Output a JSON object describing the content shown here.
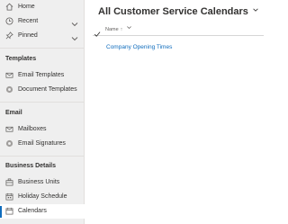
{
  "sidebar": {
    "items": {
      "home": {
        "label": "Home",
        "icon": "home-icon"
      },
      "recent": {
        "label": "Recent",
        "icon": "clock-icon"
      },
      "pinned": {
        "label": "Pinned",
        "icon": "pin-icon"
      },
      "email_templates": {
        "label": "Email Templates",
        "icon": "email-template-icon"
      },
      "document_templates": {
        "label": "Document Templates",
        "icon": "document-template-icon"
      },
      "mailboxes": {
        "label": "Mailboxes",
        "icon": "mailbox-icon"
      },
      "email_signatures": {
        "label": "Email Signatures",
        "icon": "signature-icon"
      },
      "business_units": {
        "label": "Business Units",
        "icon": "business-unit-icon"
      },
      "holiday_schedule": {
        "label": "Holiday Schedule",
        "icon": "holiday-calendar-icon"
      },
      "calendars": {
        "label": "Calendars",
        "icon": "calendar-icon",
        "selected": true
      }
    },
    "sections": {
      "templates": "Templates",
      "email": "Email",
      "business_details": "Business Details"
    }
  },
  "main": {
    "view_title": "All Customer Service Calendars",
    "columns": [
      {
        "label": "Name",
        "sort_indicator": "↑"
      }
    ],
    "rows": [
      {
        "name": "Company Opening Times"
      }
    ]
  },
  "colors": {
    "accent": "#0f6cbd",
    "sidebar_bg": "#efefef",
    "text": "#323130"
  }
}
